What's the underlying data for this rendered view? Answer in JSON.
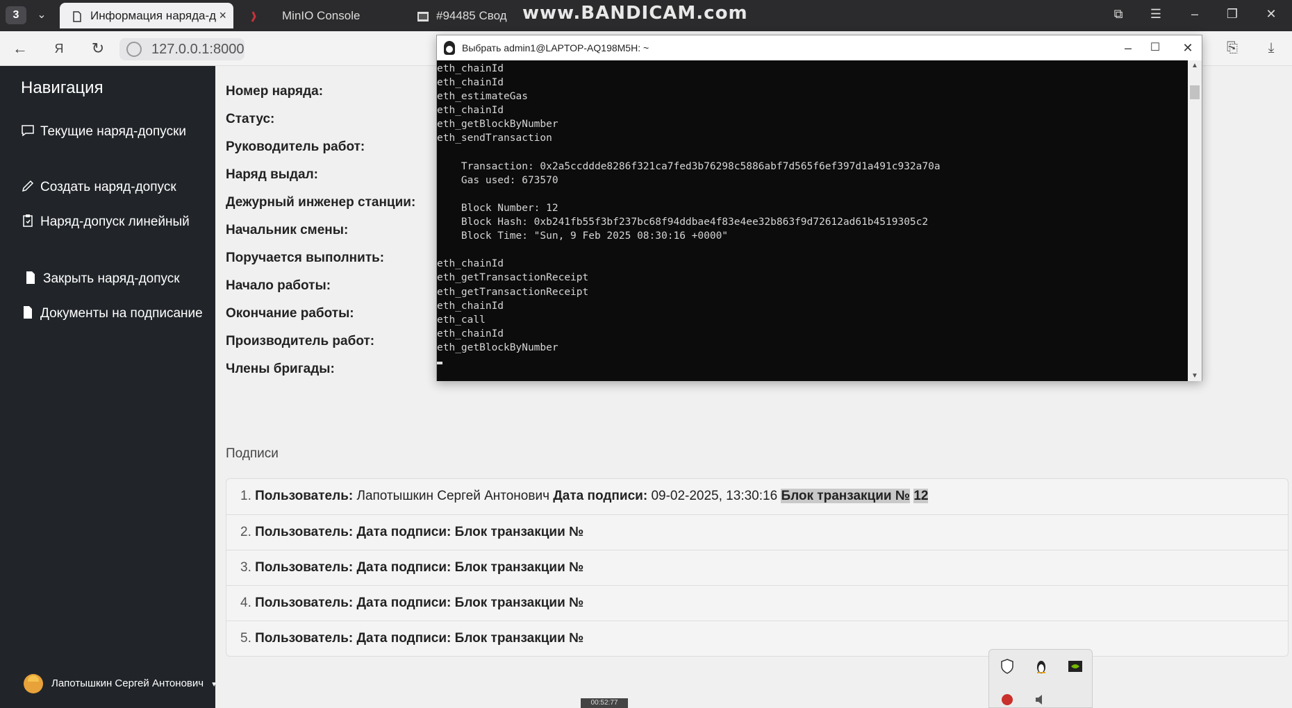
{
  "browser": {
    "tab_count": "3",
    "tabs": [
      {
        "label": "Информация наряда-д"
      },
      {
        "label": "MinIO Console"
      },
      {
        "label": "#94485 Свод"
      }
    ],
    "watermark": "www.BANDICAM.com",
    "url": "127.0.0.1:8000"
  },
  "sidebar": {
    "title": "Навигация",
    "items": [
      {
        "label": "Текущие наряд-допуски",
        "icon": "chat-icon"
      },
      {
        "label": "Создать наряд-допуск",
        "icon": "pencil-icon"
      },
      {
        "label": "Наряд-допуск линейный",
        "icon": "clipboard-icon"
      },
      {
        "label": "Закрыть наряд-допуск",
        "icon": "document-icon"
      },
      {
        "label": "Документы на подписание",
        "icon": "document-icon"
      }
    ],
    "user_name": "Лапотышкин Сергей Антонович"
  },
  "order": {
    "fields": [
      "Номер наряда:",
      "Статус:",
      "Руководитель работ:",
      "Наряд выдал:",
      "Дежурный инженер станции:",
      "Начальник смены:",
      "Поручается выполнить:",
      "Начало работы:",
      "Окончание работы:",
      "Производитель работ:",
      "Члены бригады:"
    ]
  },
  "signatures": {
    "heading": "Подписи",
    "user_label": "Пользователь:",
    "date_label": "Дата подписи:",
    "block_label": "Блок транзакции №",
    "rows": [
      {
        "num": "1.",
        "user": "Лапотышкин Сергей Антонович",
        "date": "09-02-2025, 13:30:16",
        "block": "12"
      },
      {
        "num": "2.",
        "user": "",
        "date": "",
        "block": ""
      },
      {
        "num": "3.",
        "user": "",
        "date": "",
        "block": ""
      },
      {
        "num": "4.",
        "user": "",
        "date": "",
        "block": ""
      },
      {
        "num": "5.",
        "user": "",
        "date": "",
        "block": ""
      }
    ]
  },
  "terminal": {
    "title": "Выбрать admin1@LAPTOP-AQ198M5H: ~",
    "lines": [
      "eth_chainId",
      "eth_chainId",
      "eth_estimateGas",
      "eth_chainId",
      "eth_getBlockByNumber",
      "eth_sendTransaction",
      "",
      "    Transaction: 0x2a5ccddde8286f321ca7fed3b76298c5886abf7d565f6ef397d1a491c932a70a",
      "    Gas used: 673570",
      "",
      "    Block Number: 12",
      "    Block Hash: 0xb241fb55f3bf237bc68f94ddbae4f83e4ee32b863f9d72612ad61b4519305c2",
      "    Block Time: \"Sun, 9 Feb 2025 08:30:16 +0000\"",
      "",
      "eth_chainId",
      "eth_getTransactionReceipt",
      "eth_getTransactionReceipt",
      "eth_chainId",
      "eth_call",
      "eth_chainId",
      "eth_getBlockByNumber"
    ]
  },
  "recording_time": "00:52:77"
}
